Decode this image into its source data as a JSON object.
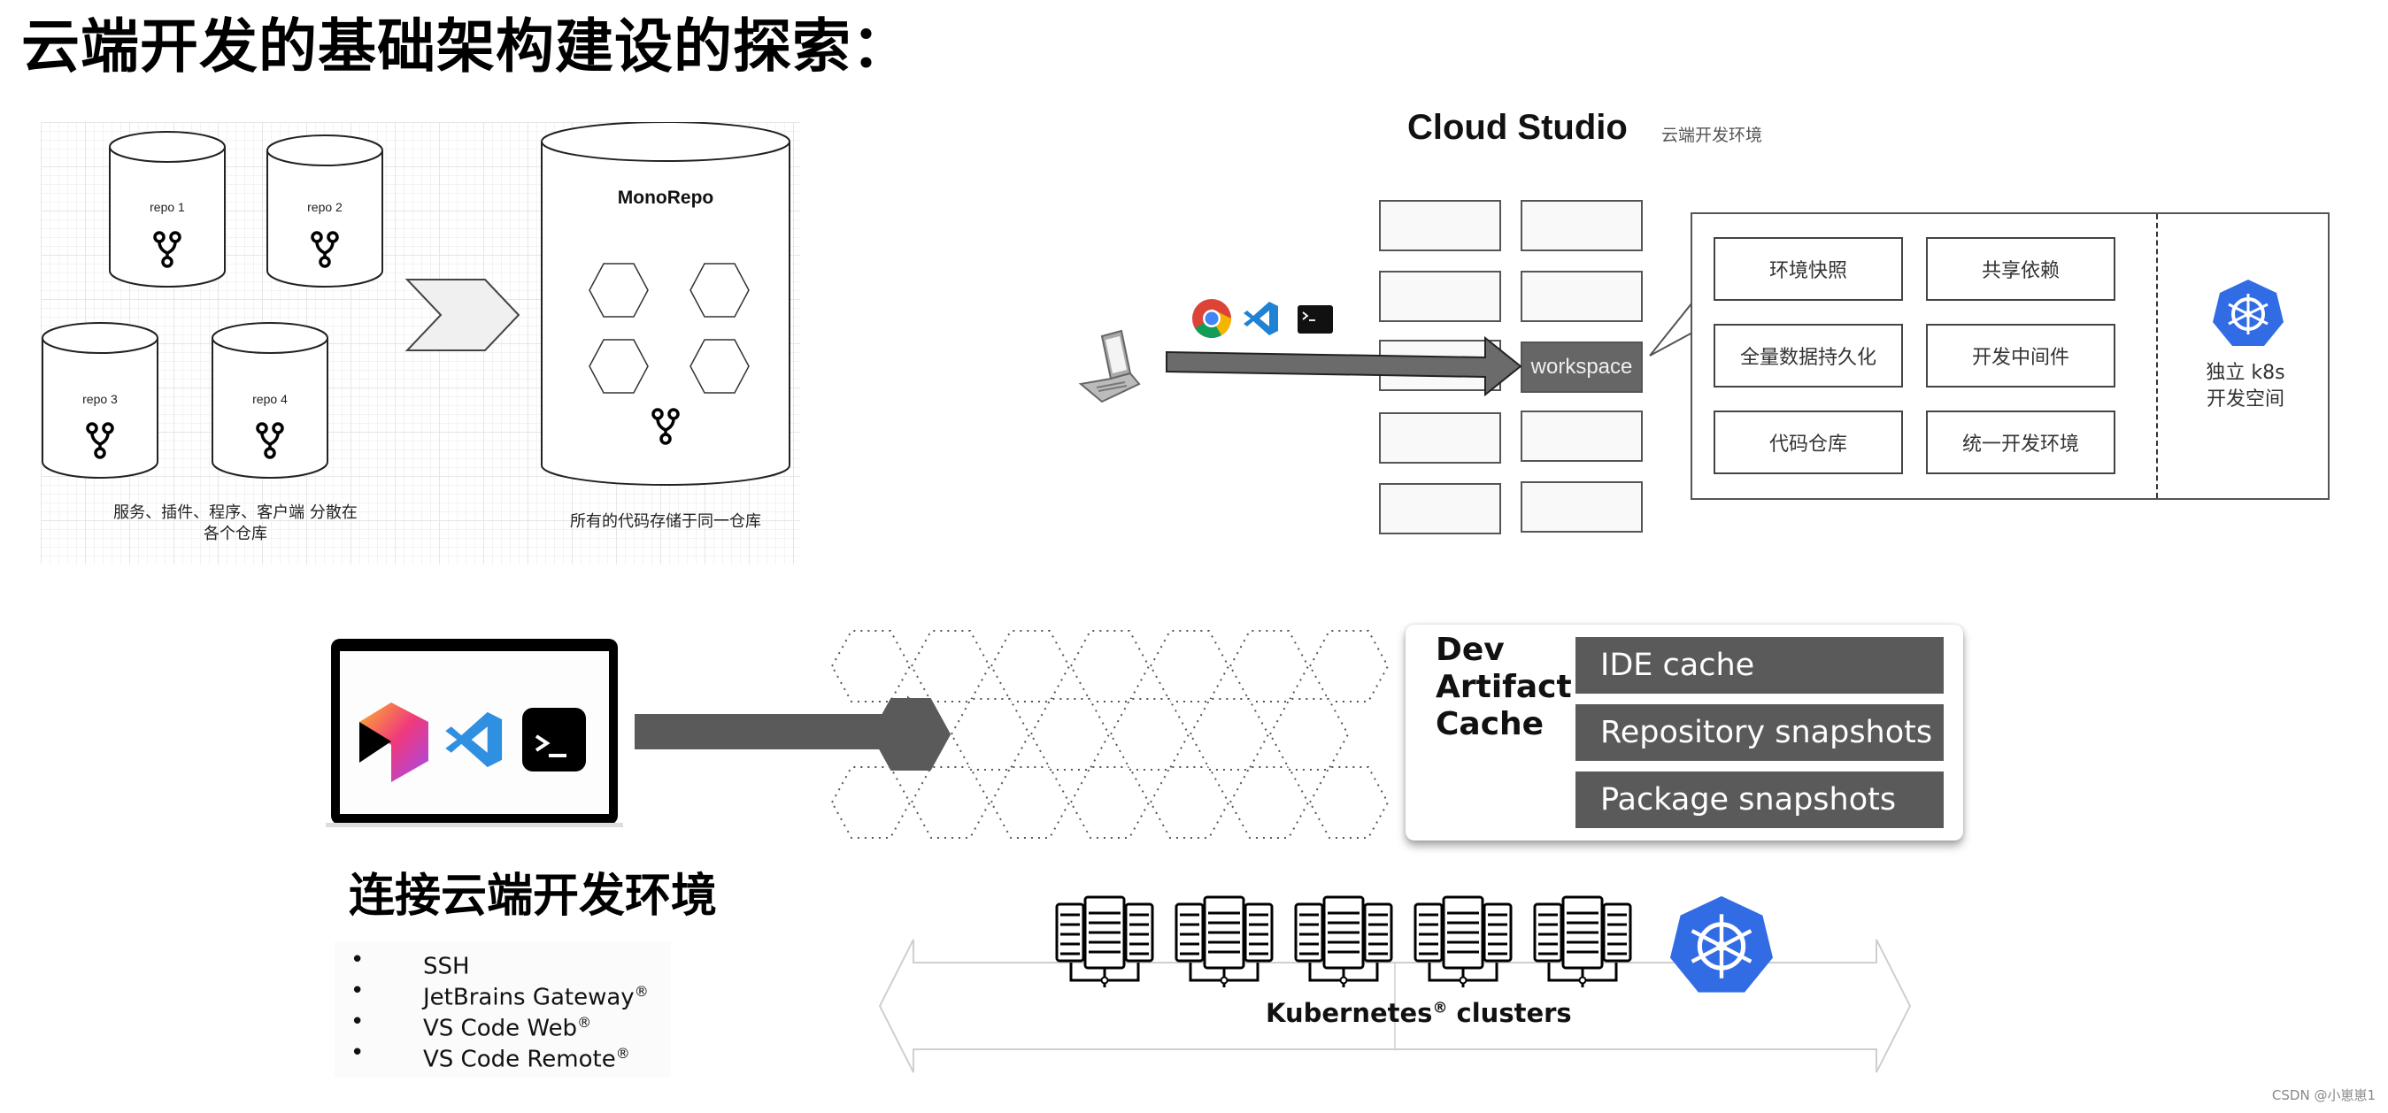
{
  "page": {
    "title": "云端开发的基础架构建设的探索："
  },
  "repo_diagram": {
    "repos": [
      {
        "label": "repo 1",
        "icon": "git-branch-icon"
      },
      {
        "label": "repo 2",
        "icon": "git-branch-icon"
      },
      {
        "label": "repo 3",
        "icon": "git-branch-icon"
      },
      {
        "label": "repo 4",
        "icon": "git-branch-icon"
      }
    ],
    "left_caption_line1": "服务、插件、程序、客户端 分散在",
    "left_caption_line2": "各个仓库",
    "arrow_icon": "chevron-right-icon",
    "monorepo": {
      "label": "MonoRepo",
      "module_count": 4,
      "icon": "git-branch-icon",
      "caption": "所有的代码存储于同一仓库"
    }
  },
  "cloud_studio": {
    "title": "Cloud Studio",
    "subtitle": "云端开发环境",
    "client_icons": [
      "laptop-icon",
      "chrome-icon",
      "vscode-icon",
      "terminal-icon"
    ],
    "workspace_label": "workspace",
    "features": [
      "环境快照",
      "共享依赖",
      "全量数据持久化",
      "开发中间件",
      "代码仓库",
      "统一开发环境"
    ],
    "k8s_icon": "kubernetes-icon",
    "k8s_label_line1": "独立 k8s",
    "k8s_label_line2": "开发空间"
  },
  "dev_artifact": {
    "client_icons": [
      "jetbrains-icon",
      "vscode-icon",
      "terminal-icon"
    ],
    "title_lines": [
      "Dev",
      "Artifact",
      "Cache"
    ],
    "items": [
      "IDE cache",
      "Repository snapshots",
      "Package snapshots"
    ]
  },
  "connect": {
    "title": "连接云端开发环境",
    "items": [
      {
        "text": "SSH",
        "mark": ""
      },
      {
        "text": "JetBrains Gateway",
        "mark": "®"
      },
      {
        "text": "VS Code Web",
        "mark": "®"
      },
      {
        "text": "VS Code Remote",
        "mark": "®"
      }
    ],
    "bullet": "•"
  },
  "clusters": {
    "server_count": 5,
    "label": "Kubernetes",
    "label_mark": "®",
    "label_suffix": " clusters",
    "k8s_icon": "kubernetes-icon"
  },
  "watermark": "CSDN @小崽崽1",
  "colors": {
    "k8s_blue": "#326CE5",
    "dark_box": "#5a5a5a",
    "workspace": "#666666"
  }
}
